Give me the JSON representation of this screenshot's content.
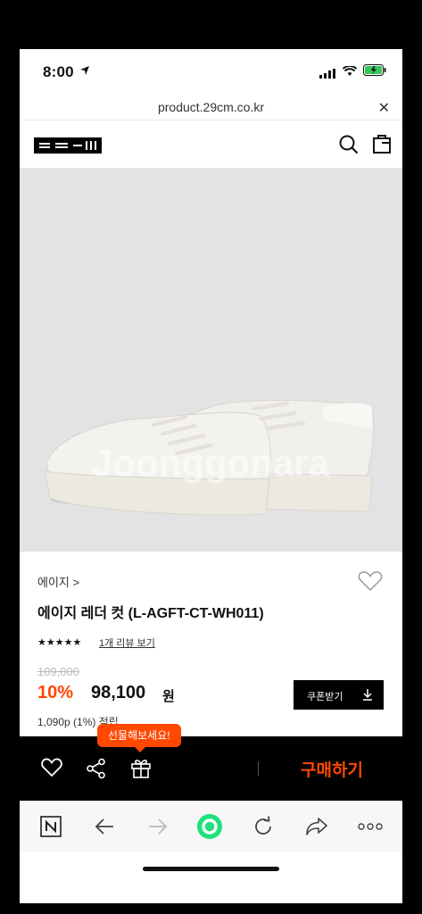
{
  "status_bar": {
    "time": "8:00"
  },
  "browser": {
    "url": "product.29cm.co.kr",
    "close_symbol": "✕"
  },
  "product": {
    "brand": "에이지 >",
    "name": "에이지 레더 컷 (L-AGFT-CT-WH011)",
    "rating_stars": "★★★★★",
    "rating": 5,
    "reviews_link": "1개 리뷰 보기",
    "original_price": "109,000",
    "discount": "10%",
    "price": "98,100",
    "currency": "원",
    "coupon_label": "쿠폰받기",
    "points": "1,090p (1%) 적립",
    "watermark": "Joonggonara"
  },
  "actions": {
    "gift_tooltip": "선물해보세요!",
    "buy_label": "구매하기"
  },
  "colors": {
    "accent": "#ff4800",
    "image_bg": "#e3e3e3",
    "actionbar_bg": "#000000",
    "browser_green": "#1ee07c"
  },
  "icons": {
    "status": [
      "location-arrow-icon",
      "signal-icon",
      "wifi-icon",
      "battery-icon"
    ],
    "header": [
      "search-icon",
      "bag-icon"
    ],
    "actions": [
      "heart-icon",
      "share-icon",
      "gift-icon"
    ],
    "browser": [
      "naver-n-icon",
      "back-arrow-icon",
      "forward-arrow-icon",
      "green-circle-icon",
      "reload-icon",
      "share-arrow-icon",
      "more-dots-icon"
    ]
  }
}
